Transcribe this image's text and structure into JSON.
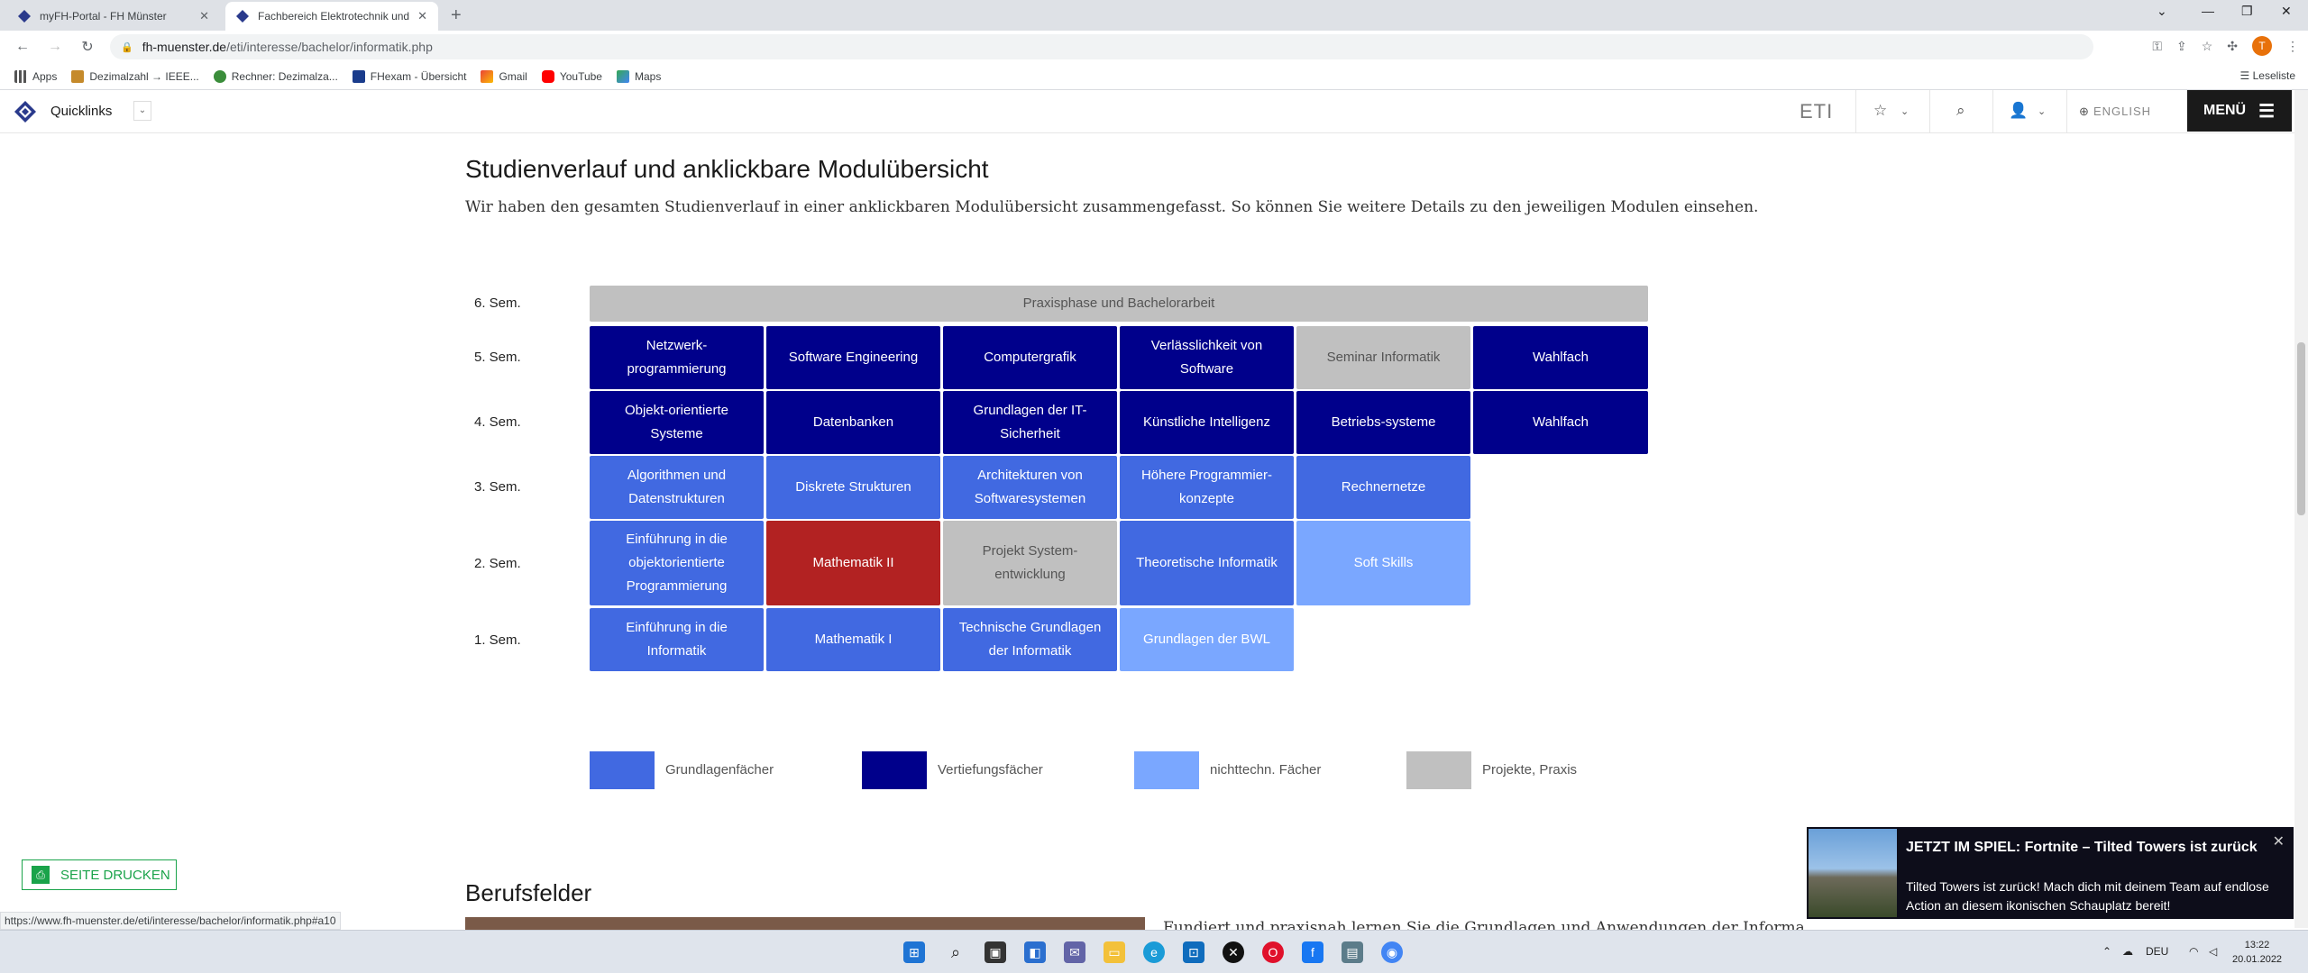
{
  "browser": {
    "tabs": [
      {
        "label": "myFH-Portal - FH Münster",
        "active": false
      },
      {
        "label": "Fachbereich Elektrotechnik und In",
        "active": true
      }
    ],
    "url_host": "fh-muenster.de",
    "url_path": "/eti/interesse/bachelor/informatik.php",
    "bookmarks": [
      "Apps",
      "Dezimalzahl → IEEE...",
      "Rechner: Dezimalza...",
      "FHexam - Übersicht",
      "Gmail",
      "YouTube",
      "Maps"
    ],
    "reading_list": "Leseliste",
    "profile_initial": "T",
    "status_url": "https://www.fh-muenster.de/eti/interesse/bachelor/informatik.php#a10"
  },
  "site": {
    "quicklinks": "Quicklinks",
    "dept": "ETI",
    "language": "ENGLISH",
    "menu": "MENÜ"
  },
  "section": {
    "title": "Studienverlauf und anklickbare Modulübersicht",
    "intro": "Wir haben den gesamten Studienverlauf in einer anklickbaren Modulübersicht zusammengefasst. So können Sie weitere Details zu den jeweiligen Modulen einsehen."
  },
  "semesters": [
    {
      "label": "6. Sem.",
      "modules": [
        {
          "name": "Praxisphase und Bachelorarbeit",
          "type": "projekt"
        }
      ]
    },
    {
      "label": "5. Sem.",
      "modules": [
        {
          "name": "Netzwerk-programmierung",
          "type": "vertiefung"
        },
        {
          "name": "Software Engineering",
          "type": "vertiefung"
        },
        {
          "name": "Computergrafik",
          "type": "vertiefung"
        },
        {
          "name": "Verlässlichkeit von Software",
          "type": "vertiefung"
        },
        {
          "name": "Seminar Informatik",
          "type": "projekt"
        },
        {
          "name": "Wahlfach",
          "type": "vertiefung"
        }
      ]
    },
    {
      "label": "4. Sem.",
      "modules": [
        {
          "name": "Objekt-orientierte Systeme",
          "type": "vertiefung"
        },
        {
          "name": "Datenbanken",
          "type": "vertiefung"
        },
        {
          "name": "Grundlagen der IT-Sicherheit",
          "type": "vertiefung"
        },
        {
          "name": "Künstliche Intelligenz",
          "type": "vertiefung"
        },
        {
          "name": "Betriebs-systeme",
          "type": "vertiefung"
        },
        {
          "name": "Wahlfach",
          "type": "vertiefung"
        }
      ]
    },
    {
      "label": "3. Sem.",
      "modules": [
        {
          "name": "Algorithmen und Datenstrukturen",
          "type": "grundlagen"
        },
        {
          "name": "Diskrete Strukturen",
          "type": "grundlagen"
        },
        {
          "name": "Architekturen von Softwaresystemen",
          "type": "grundlagen"
        },
        {
          "name": "Höhere Programmier-konzepte",
          "type": "grundlagen"
        },
        {
          "name": "Rechnernetze",
          "type": "grundlagen"
        }
      ]
    },
    {
      "label": "2. Sem.",
      "modules": [
        {
          "name": "Einführung in die objektorientierte Programmierung",
          "type": "grundlagen"
        },
        {
          "name": "Mathematik II",
          "type": "selected"
        },
        {
          "name": "Projekt System-entwicklung",
          "type": "projekt"
        },
        {
          "name": "Theoretische Informatik",
          "type": "grundlagen"
        },
        {
          "name": "Soft Skills",
          "type": "nichttechn"
        }
      ]
    },
    {
      "label": "1. Sem.",
      "modules": [
        {
          "name": "Einführung in die Informatik",
          "type": "grundlagen"
        },
        {
          "name": "Mathematik I",
          "type": "grundlagen"
        },
        {
          "name": "Technische Grundlagen der Informatik",
          "type": "grundlagen"
        },
        {
          "name": "Grundlagen der BWL",
          "type": "nichttechn"
        }
      ]
    }
  ],
  "legend": [
    {
      "label": "Grundlagenfächer",
      "color": "#4169e1"
    },
    {
      "label": "Vertiefungsfächer",
      "color": "#00008b"
    },
    {
      "label": "nichttechn. Fächer",
      "color": "#7aa7ff"
    },
    {
      "label": "Projekte, Praxis",
      "color": "#c0c0c0"
    }
  ],
  "print_button": "SEITE DRUCKEN",
  "beruf": {
    "title": "Berufsfelder",
    "text": "Fundiert und praxisnah lernen Sie die Grundlagen und Anwendungen der Informatik"
  },
  "notification": {
    "title": "JETZT IM SPIEL: Fortnite – Tilted Towers ist zurück",
    "body": "Tilted Towers ist zurück! Mach dich mit deinem Team auf endlose Action an diesem ikonischen Schauplatz bereit!"
  },
  "taskbar": {
    "lang": "DEU",
    "time": "13:22",
    "date": "20.01.2022"
  }
}
